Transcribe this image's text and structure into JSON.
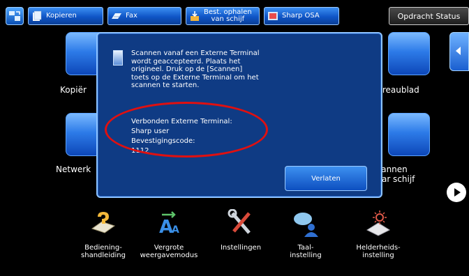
{
  "topbar": {
    "tabs": [
      {
        "label": "Kopieren",
        "icon": "copy-icon"
      },
      {
        "label": "Fax",
        "icon": "fax-icon"
      },
      {
        "label": "Best. ophalen\nvan schijf",
        "icon": "retrieve-file-icon"
      },
      {
        "label": "Sharp OSA",
        "icon": "osa-icon"
      }
    ],
    "status_label": "Opdracht Status"
  },
  "home": {
    "tiles": [
      {
        "label": "Kopiër"
      },
      {
        "label": "Bureaublad"
      },
      {
        "label": "Netwerk"
      },
      {
        "label": "Scannen\nnaar schijf"
      }
    ]
  },
  "dialog": {
    "message": "Scannen vanaf een Externe Terminal\nwordt geaccepteerd. Plaats het\norigineel. Druk op de  [Scannen]\ntoets op de Externe Terminal om het\nscannen te starten.",
    "connected_label": "Verbonden Externe Terminal:",
    "user": "Sharp user",
    "code_label": "Bevestigingscode:",
    "code_value": "1112",
    "exit_label": "Verlaten"
  },
  "bottom": {
    "items": [
      {
        "label": "Bediening-\nshandleiding",
        "icon": "manual-book-icon"
      },
      {
        "label": "Vergrote\nweergavemodus",
        "icon": "enlarge-text-icon"
      },
      {
        "label": "Instellingen",
        "icon": "tools-icon"
      },
      {
        "label": "Taal-\ninstelling",
        "icon": "language-icon"
      },
      {
        "label": "Helderheids-\ninstelling",
        "icon": "brightness-icon"
      }
    ]
  },
  "colors": {
    "dialog_bg": "#0f3b84",
    "button_blue": "#1c62d4",
    "highlight_ellipse": "#e01010"
  }
}
